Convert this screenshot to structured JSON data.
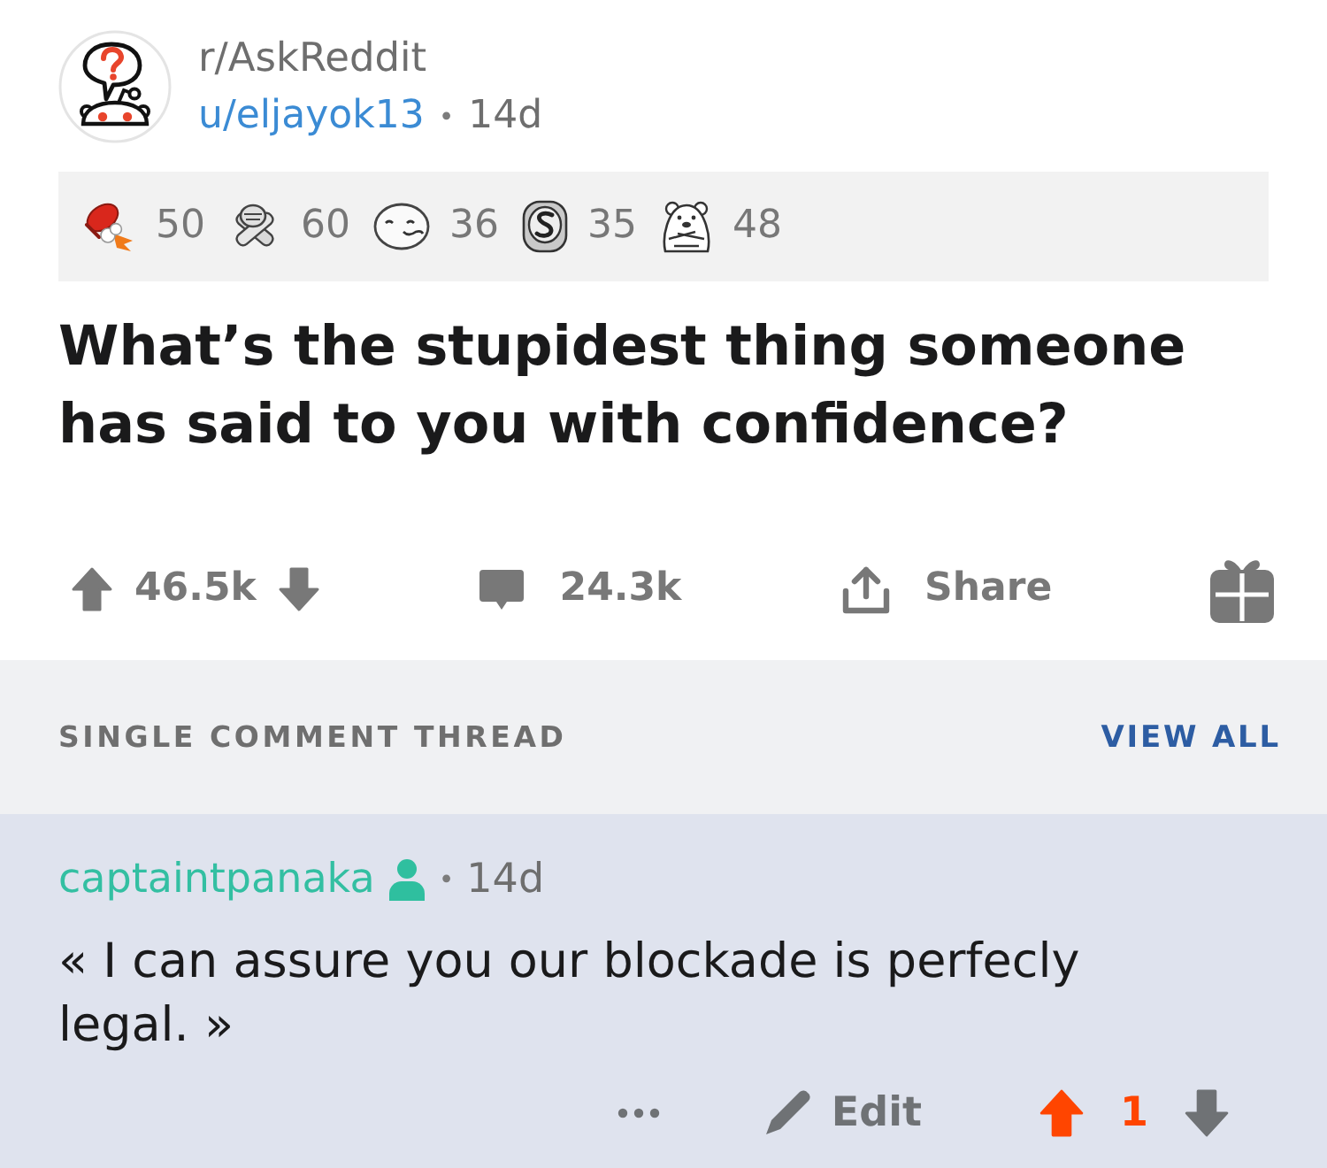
{
  "post": {
    "subreddit": "r/AskReddit",
    "author": "u/eljayok13",
    "separator": "•",
    "age": "14d"
  },
  "awards": [
    {
      "count": "50"
    },
    {
      "count": "60"
    },
    {
      "count": "36"
    },
    {
      "count": "35"
    },
    {
      "count": "48"
    }
  ],
  "title": "What’s the stupidest thing someone has said to you with confidence?",
  "actions": {
    "score": "46.5k",
    "upvoted": false,
    "downvoted": false,
    "comments": "24.3k",
    "share": "Share"
  },
  "thread_header": {
    "label": "SINGLE COMMENT THREAD",
    "view_all": "VIEW ALL"
  },
  "comment": {
    "author": "captaintpanaka",
    "separator": "•",
    "age": "14d",
    "body": "« I can assure you our blockade is perfecly legal. »",
    "edit": "Edit",
    "score": "1",
    "upvoted": true,
    "downvoted": false
  }
}
